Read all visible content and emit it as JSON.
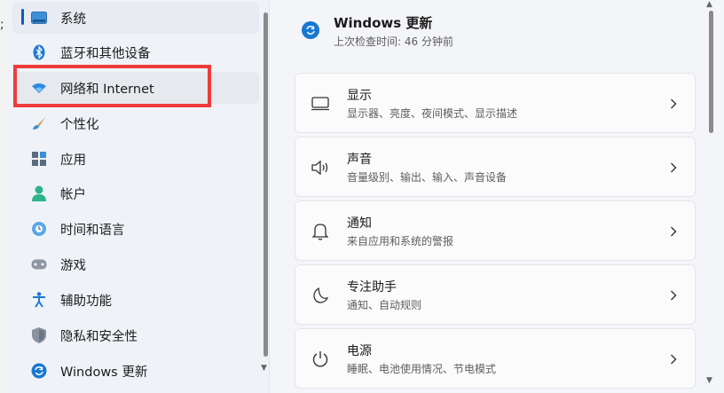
{
  "sidebar": {
    "items": [
      {
        "label": "系统",
        "icon": "system-display-icon"
      },
      {
        "label": "蓝牙和其他设备",
        "icon": "bluetooth-icon"
      },
      {
        "label": "网络和 Internet",
        "icon": "wifi-icon"
      },
      {
        "label": "个性化",
        "icon": "brush-icon"
      },
      {
        "label": "应用",
        "icon": "apps-icon"
      },
      {
        "label": "帐户",
        "icon": "account-icon"
      },
      {
        "label": "时间和语言",
        "icon": "globe-clock-icon"
      },
      {
        "label": "游戏",
        "icon": "gamepad-icon"
      },
      {
        "label": "辅助功能",
        "icon": "accessibility-icon"
      },
      {
        "label": "隐私和安全性",
        "icon": "shield-icon"
      },
      {
        "label": "Windows 更新",
        "icon": "windows-update-icon"
      }
    ],
    "selected_index": 0,
    "highlighted_index": 2
  },
  "main": {
    "header": {
      "title": "Windows 更新",
      "subtitle": "上次检查时间: 46 分钟前"
    },
    "cards": [
      {
        "title": "显示",
        "subtitle": "显示器、亮度、夜间模式、显示描述",
        "icon": "monitor-icon"
      },
      {
        "title": "声音",
        "subtitle": "音量级别、输出、输入、声音设备",
        "icon": "speaker-icon"
      },
      {
        "title": "通知",
        "subtitle": "来自应用和系统的警报",
        "icon": "bell-icon"
      },
      {
        "title": "专注助手",
        "subtitle": "通知、自动规则",
        "icon": "moon-icon"
      },
      {
        "title": "电源",
        "subtitle": "睡眠、电池使用情况、节电模式",
        "icon": "power-icon"
      }
    ]
  },
  "colors": {
    "accent": "#005fb8",
    "highlight": "#ee3b3b"
  }
}
